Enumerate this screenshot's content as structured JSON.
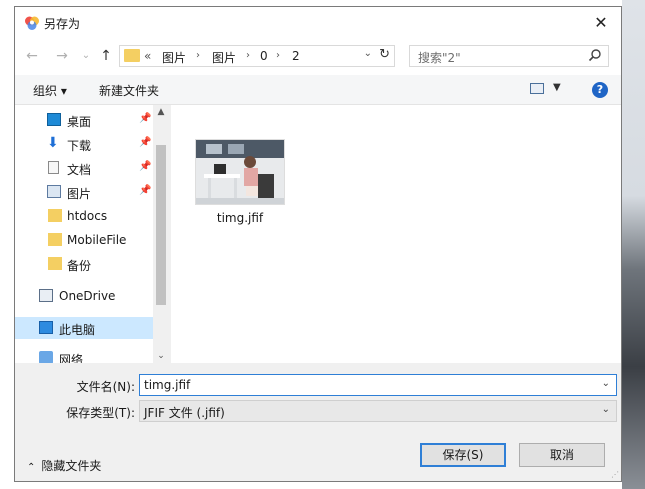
{
  "window": {
    "title": "另存为",
    "close": "✕"
  },
  "navbar": {
    "back": "←",
    "forward": "→",
    "recent": "⌄",
    "up": "↑",
    "address": {
      "overflow": "«",
      "segments": [
        "图片",
        "图片",
        "0",
        "2"
      ],
      "separator": "›"
    },
    "search_placeholder": "搜索\"2\""
  },
  "toolbar": {
    "organize": "组织 ▾",
    "new_folder": "新建文件夹",
    "help": "?"
  },
  "nav_pane": {
    "items": [
      {
        "label": "桌面",
        "icon": "desktop-icon",
        "pinned": true
      },
      {
        "label": "下载",
        "icon": "download-icon",
        "pinned": true
      },
      {
        "label": "文档",
        "icon": "document-icon",
        "pinned": true
      },
      {
        "label": "图片",
        "icon": "pictures-icon",
        "pinned": true
      },
      {
        "label": "htdocs",
        "icon": "folder-icon",
        "pinned": false
      },
      {
        "label": "MobileFile",
        "icon": "folder-icon",
        "pinned": false
      },
      {
        "label": "备份",
        "icon": "folder-icon",
        "pinned": false
      },
      {
        "label": "OneDrive",
        "icon": "onedrive-icon",
        "pinned": false
      },
      {
        "label": "此电脑",
        "icon": "computer-icon",
        "pinned": false,
        "selected": true
      },
      {
        "label": "网络",
        "icon": "network-icon",
        "pinned": false
      }
    ],
    "pin_glyph": "📌"
  },
  "files": [
    {
      "name": "timg.jfif"
    }
  ],
  "form": {
    "filename_label": "文件名(N):",
    "filename_value": "timg.jfif",
    "filetype_label": "保存类型(T):",
    "filetype_value": "JFIF 文件 (.jfif)",
    "hide_folders": "隐藏文件夹",
    "save_button": "保存(S)",
    "cancel_button": "取消"
  },
  "colors": {
    "accent": "#2f7fd6",
    "selected_bg": "#cce8ff",
    "folder": "#f4cf62"
  }
}
